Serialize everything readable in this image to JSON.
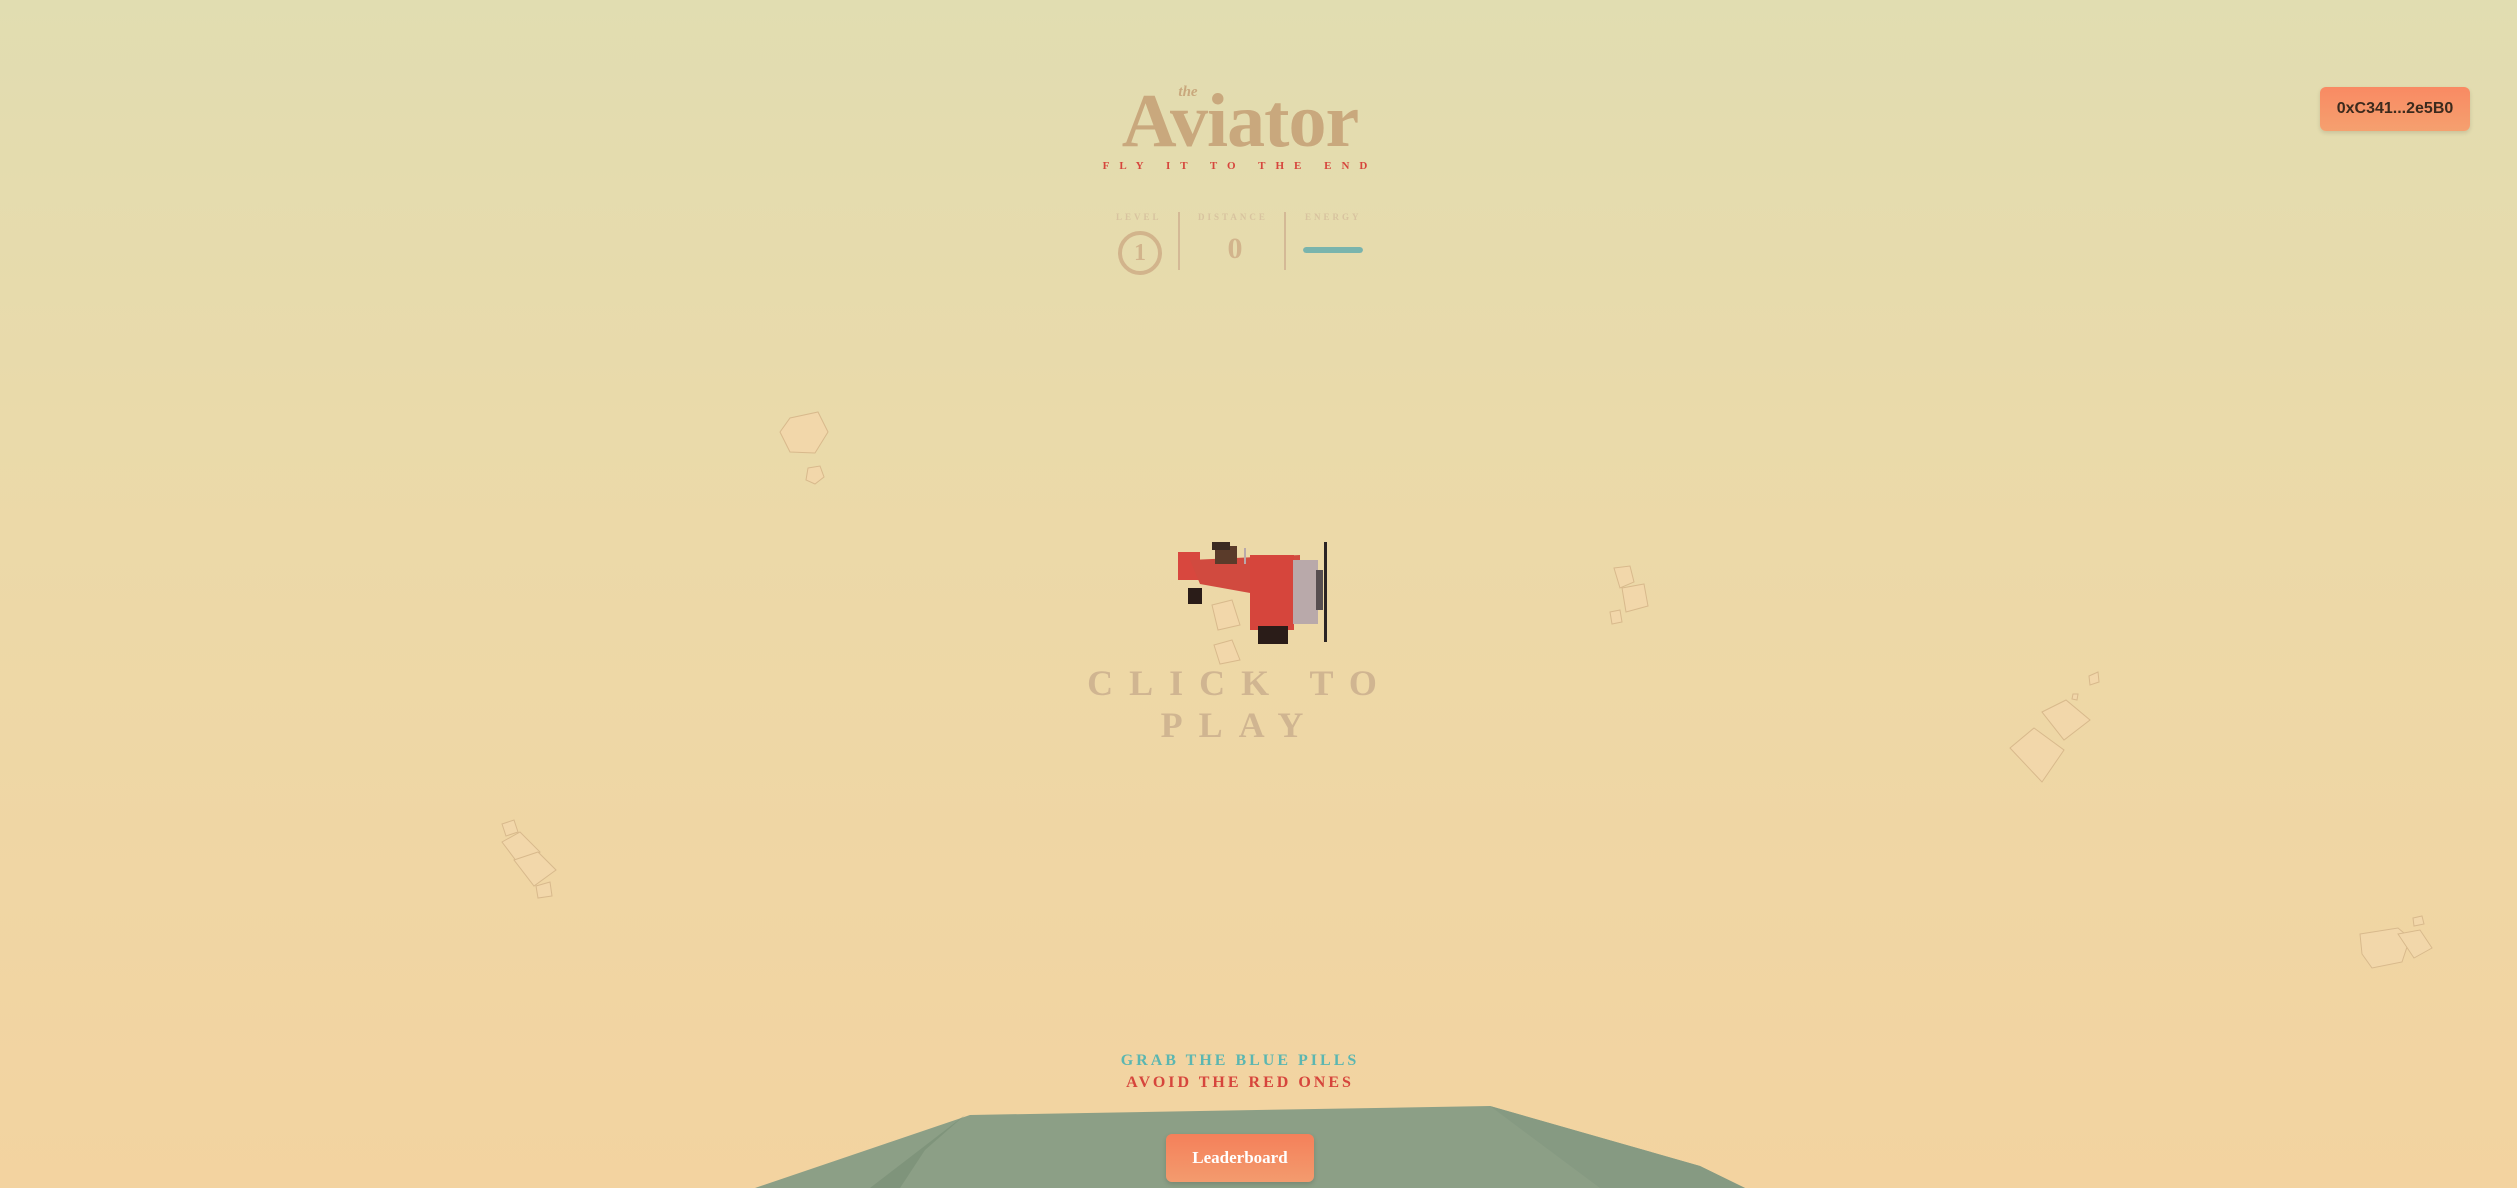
{
  "wallet": {
    "address": "0xC341...2e5B0"
  },
  "title": {
    "prefix": "the",
    "name": "Aviator",
    "tagline": "FLY IT TO THE END"
  },
  "stats": {
    "level_label": "LEVEL",
    "level_value": "1",
    "distance_label": "DISTANCE",
    "distance_value": "0",
    "energy_label": "ENERGY",
    "energy_fraction": 1.0
  },
  "prompt": {
    "click_to_play": "CLICK TO PLAY"
  },
  "instructions": {
    "line1": "GRAB THE BLUE PILLS",
    "line2": "AVOID THE RED ONES"
  },
  "leaderboard": {
    "label": "Leaderboard"
  },
  "colors": {
    "title": "#c9a87d",
    "accent_red": "#d6453c",
    "accent_teal": "#5bb6b1",
    "button": "#f4805a",
    "plane_body": "#d8473e",
    "sea": "#8aa38a"
  },
  "icons": {
    "plane": "airplane-icon",
    "clouds": "cloud-icon"
  }
}
